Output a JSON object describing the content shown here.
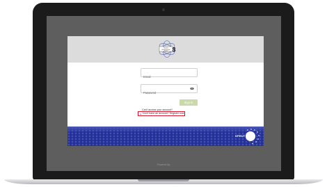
{
  "logo": {
    "line1": "Clarion",
    "line2": "Bethel Schools",
    "line3": "Sangeet",
    "number": "3"
  },
  "login": {
    "email_placeholder": "Email",
    "password_placeholder": "Password",
    "signin_label": "Sign in",
    "forgot_text": "Can't access your account?",
    "register_text": "Don't have an account? Register now."
  },
  "branding": {
    "footer_logo_text": "SPRUT"
  },
  "footer": {
    "powered_text": "Powered By"
  },
  "colors": {
    "footer_blue": "#23319a",
    "signin_green": "#c9d9a8",
    "highlight_red": "#e0142a",
    "header_gray": "#dcdcdc"
  },
  "icons": [
    "show-password-icon",
    "highlight-arrow-icon"
  ]
}
